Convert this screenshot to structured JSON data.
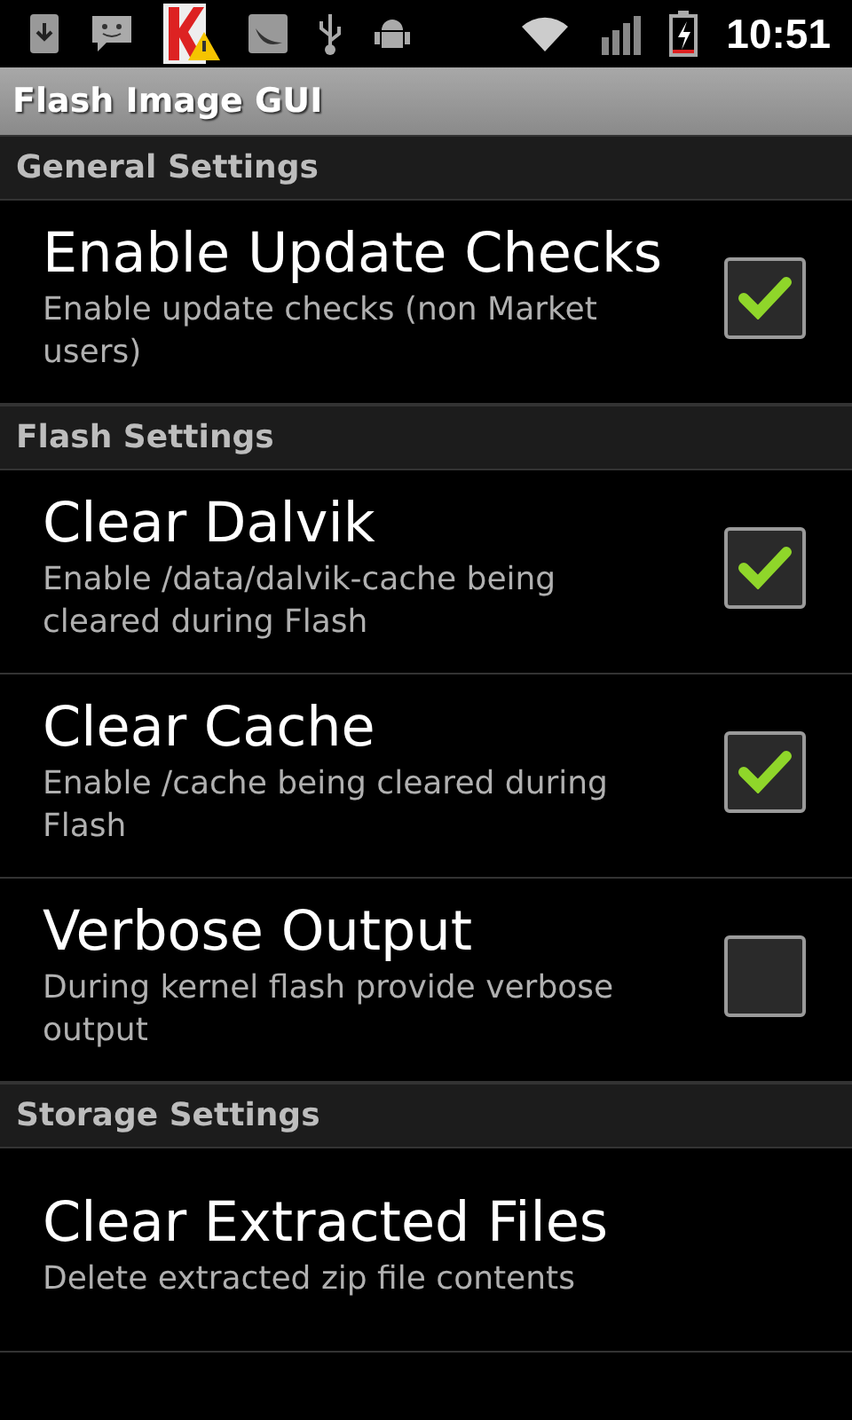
{
  "status_bar": {
    "time": "10:51"
  },
  "window": {
    "title": "Flash Image GUI"
  },
  "sections": [
    {
      "title": "General Settings",
      "items": [
        {
          "kind": "checkbox",
          "title": "Enable Update Checks",
          "summary": "Enable update checks (non Market users)",
          "checked": true
        }
      ]
    },
    {
      "title": "Flash Settings",
      "items": [
        {
          "kind": "checkbox",
          "title": "Clear Dalvik",
          "summary": "Enable /data/dalvik-cache being cleared during Flash",
          "checked": true
        },
        {
          "kind": "checkbox",
          "title": "Clear Cache",
          "summary": "Enable /cache being cleared during Flash",
          "checked": true
        },
        {
          "kind": "checkbox",
          "title": "Verbose Output",
          "summary": "During kernel flash provide verbose output",
          "checked": false
        }
      ]
    },
    {
      "title": "Storage Settings",
      "items": [
        {
          "kind": "plain",
          "title": "Clear Extracted Files",
          "summary": "Delete extracted zip file contents"
        }
      ]
    }
  ]
}
